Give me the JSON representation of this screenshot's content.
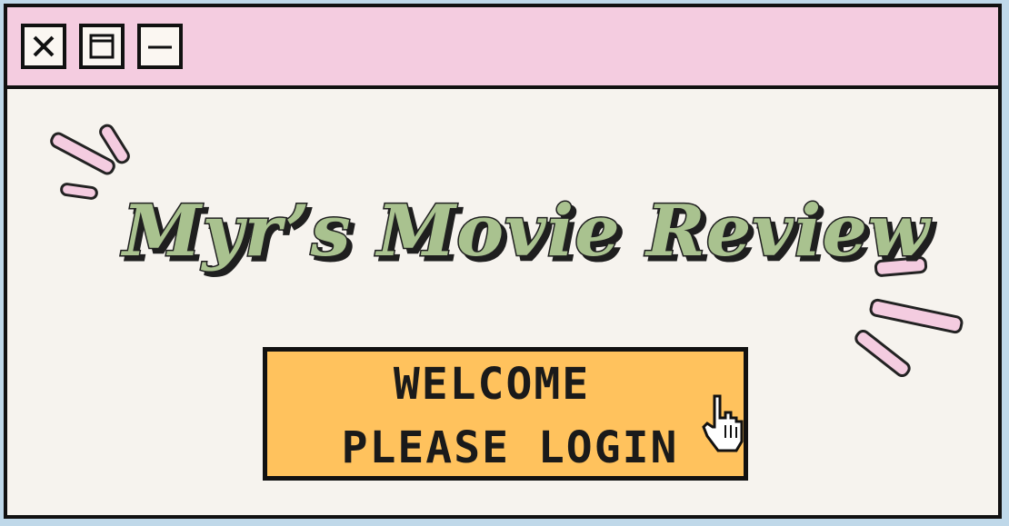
{
  "window": {
    "controls": [
      {
        "name": "close",
        "icon": "close-icon"
      },
      {
        "name": "maximize",
        "icon": "maximize-icon"
      },
      {
        "name": "minimize",
        "icon": "minimize-icon"
      }
    ]
  },
  "title": "Myr’s Movie Review",
  "login_button": {
    "line1": "WELCOME",
    "line2": "PLEASE LOGIN"
  },
  "cursor": {
    "icon": "hand-pointer-icon"
  },
  "colors": {
    "titlebar": "#f4cce0",
    "background": "#f6f3ee",
    "title_fill": "#a9c28f",
    "button_fill": "#ffc25d",
    "accent_dash": "#f4cce0",
    "outline": "#111111"
  }
}
